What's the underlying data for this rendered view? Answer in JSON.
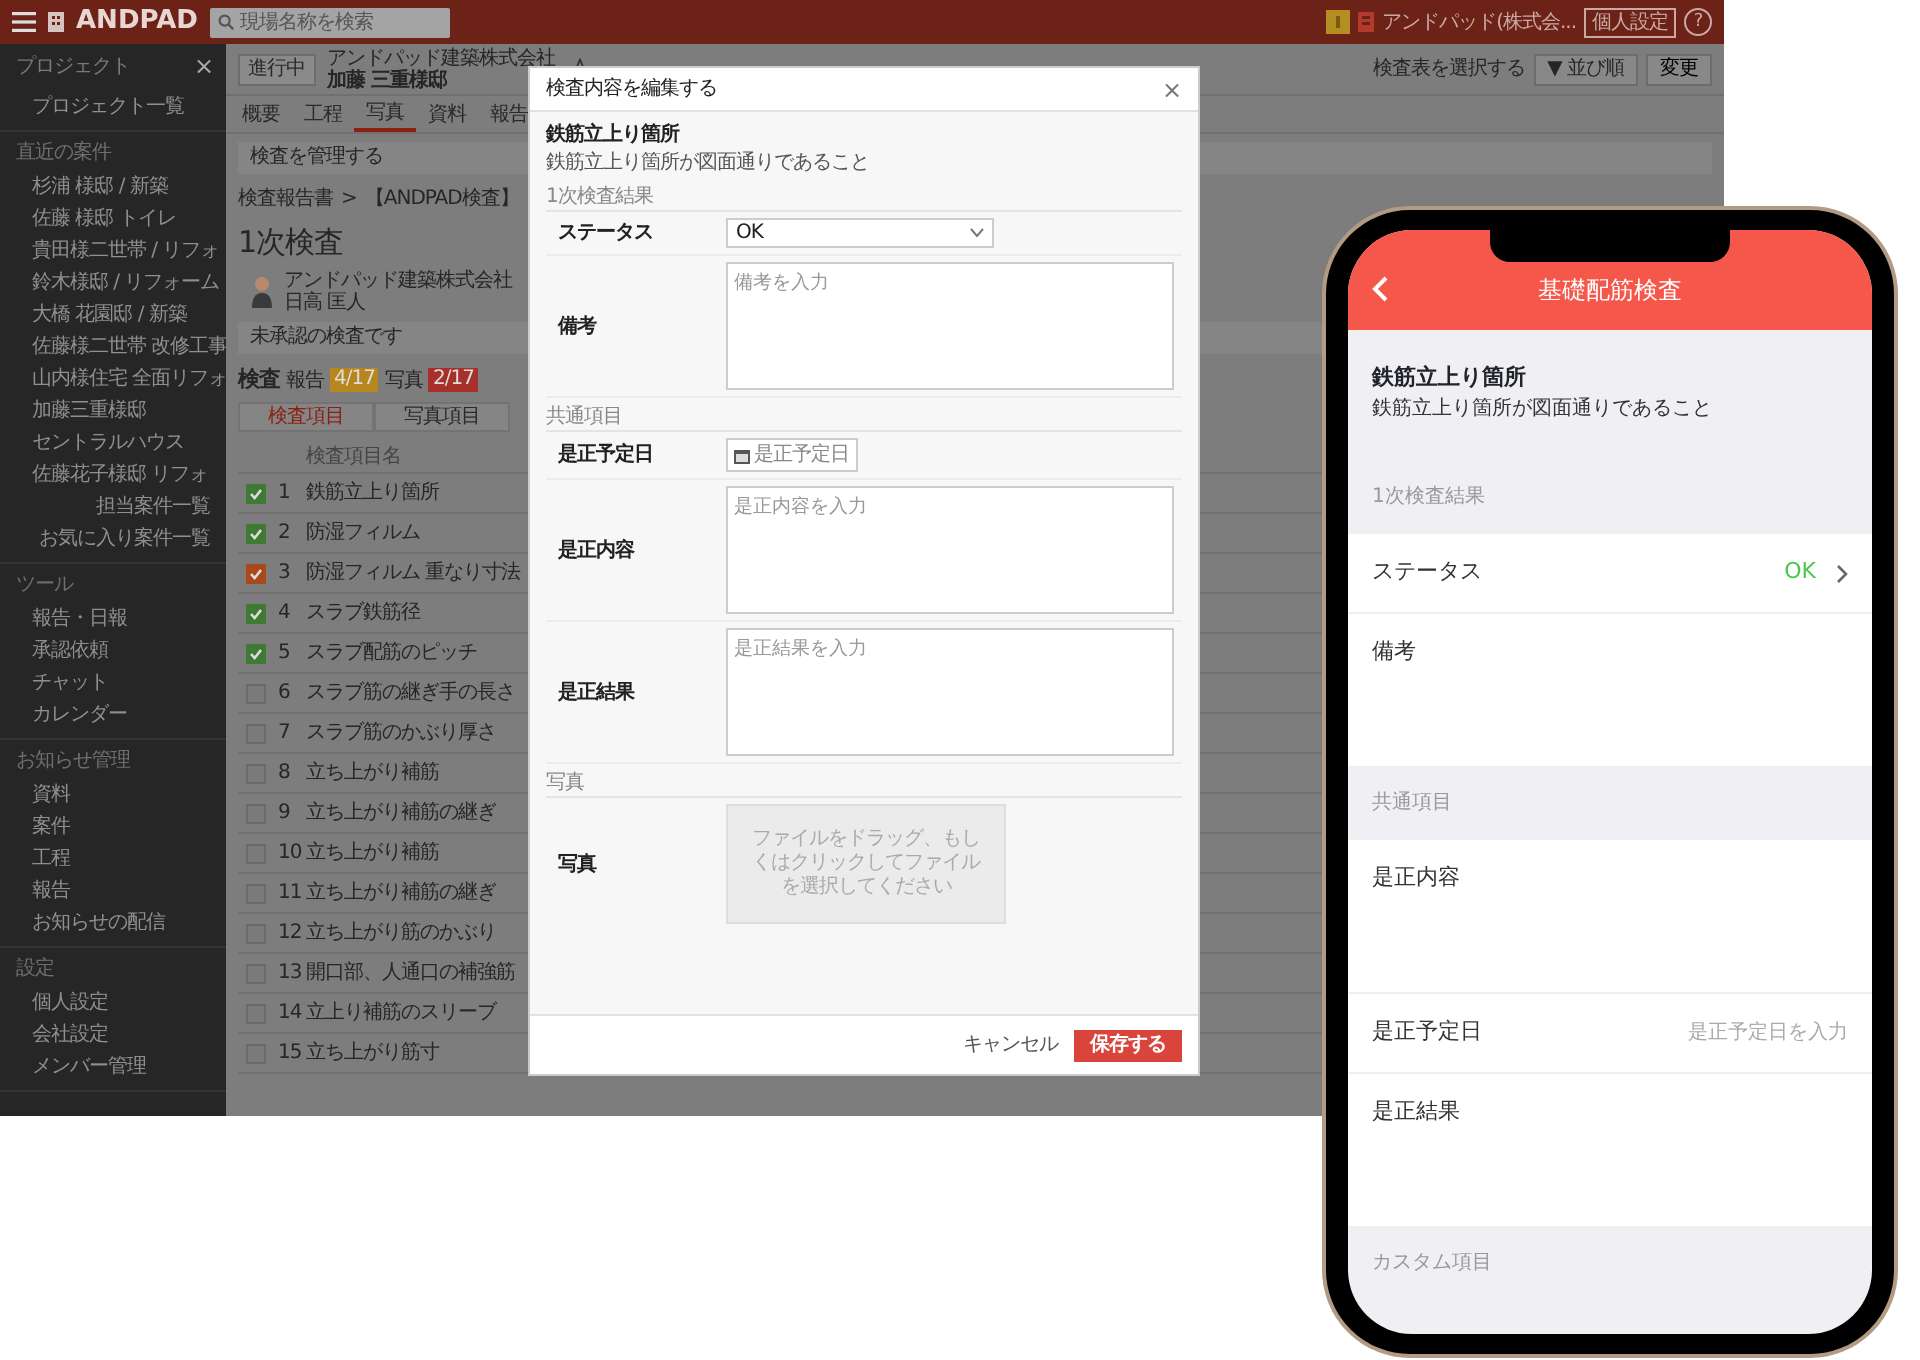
{
  "topbar": {
    "logo": "ANDPAD",
    "search_placeholder": "現場名称を検索",
    "user": "アンドパッド(株式会...",
    "settings_button": "個人設定",
    "help": "?"
  },
  "sidebar": {
    "title": "プロジェクト",
    "close": "×",
    "sections": [
      {
        "items": [
          {
            "label": "プロジェクト一覧",
            "kind": "item"
          }
        ]
      },
      {
        "heading": "直近の案件",
        "items": [
          {
            "label": "杉浦 様邸 / 新築",
            "kind": "item"
          },
          {
            "label": "佐藤 様邸 トイレ",
            "kind": "item"
          },
          {
            "label": "貴田様二世帯 / リフォ",
            "kind": "item"
          },
          {
            "label": "鈴木様邸 / リフォーム",
            "kind": "item"
          },
          {
            "label": "大橋 花園邸 / 新築",
            "kind": "item"
          },
          {
            "label": "佐藤様二世帯 改修工事",
            "kind": "item"
          },
          {
            "label": "山内様住宅 全面リフォ",
            "kind": "item"
          },
          {
            "label": "加藤三重様邸",
            "kind": "item"
          },
          {
            "label": "セントラルハウス",
            "kind": "item"
          },
          {
            "label": "佐藤花子様邸 リフォ",
            "kind": "item"
          },
          {
            "label": "担当案件一覧",
            "kind": "shortcut"
          },
          {
            "label": "お気に入り案件一覧",
            "kind": "shortcut"
          }
        ]
      },
      {
        "heading": "ツール",
        "items": [
          {
            "label": "報告・日報",
            "kind": "item"
          },
          {
            "label": "承認依頼",
            "kind": "item"
          },
          {
            "label": "チャット",
            "kind": "item"
          },
          {
            "label": "カレンダー",
            "kind": "item"
          }
        ]
      },
      {
        "heading": "お知らせ管理",
        "items": [
          {
            "label": "資料",
            "kind": "item"
          },
          {
            "label": "案件",
            "kind": "item"
          },
          {
            "label": "工程",
            "kind": "item"
          },
          {
            "label": "報告",
            "kind": "item"
          },
          {
            "label": "お知らせの配信",
            "kind": "item"
          }
        ]
      },
      {
        "heading": "設定",
        "items": [
          {
            "label": "個人設定",
            "kind": "item"
          },
          {
            "label": "会社設定",
            "kind": "item"
          },
          {
            "label": "メンバー管理",
            "kind": "item"
          }
        ]
      }
    ]
  },
  "main": {
    "project": {
      "status": "進行中",
      "company": "アンドパッド建築株式会社",
      "name": "加藤 三重様邸",
      "starred": false
    },
    "toolbar": {
      "label": "検査表を選択する",
      "select": "▼ 並び順",
      "button": "変更"
    },
    "tabs": [
      {
        "label": "概要",
        "selected": false
      },
      {
        "label": "工程",
        "selected": false
      },
      {
        "label": "写真",
        "selected": true
      },
      {
        "label": "資料",
        "selected": false
      },
      {
        "label": "報告",
        "selected": false
      }
    ],
    "section_bar": "検査を管理する",
    "breadcrumb": {
      "items": [
        "検査報告書",
        "【ANDPAD検査】"
      ],
      "separator": ">"
    },
    "title": "1次検査",
    "inspector": {
      "company": "アンドパッド建築株式会社",
      "name": "日高 匡人"
    },
    "notice": "未承認の検査です",
    "summary": {
      "label": "検査",
      "counts": [
        {
          "label": "報告",
          "value": "4/17",
          "color": "#b7861f"
        },
        {
          "label": "写真",
          "value": "2/17",
          "color": "#a8302a"
        }
      ]
    },
    "list_tabs": [
      {
        "label": "検査項目",
        "selected": true
      },
      {
        "label": "写真項目",
        "selected": false
      }
    ],
    "list": {
      "column": "検査項目名",
      "rows": [
        {
          "number": "1",
          "name": "鉄筋立上り箇所",
          "checked": true,
          "color": "#3f7a35"
        },
        {
          "number": "2",
          "name": "防湿フィルム",
          "checked": true,
          "color": "#3f7a35"
        },
        {
          "number": "3",
          "name": "防湿フィルム 重なり寸法",
          "checked": true,
          "color": "#a8491a"
        },
        {
          "number": "4",
          "name": "スラブ鉄筋径",
          "checked": true,
          "color": "#3f7a35"
        },
        {
          "number": "5",
          "name": "スラブ配筋のピッチ",
          "checked": true,
          "color": "#3f7a35"
        },
        {
          "number": "6",
          "name": "スラブ筋の継ぎ手の長さ",
          "checked": false
        },
        {
          "number": "7",
          "name": "スラブ筋のかぶり厚さ",
          "checked": false
        },
        {
          "number": "8",
          "name": "立ち上がり補筋",
          "checked": false
        },
        {
          "number": "9",
          "name": "立ち上がり補筋の継ぎ",
          "checked": false
        },
        {
          "number": "10",
          "name": "立ち上がり補筋",
          "checked": false
        },
        {
          "number": "11",
          "name": "立ち上がり補筋の継ぎ",
          "checked": false
        },
        {
          "number": "12",
          "name": "立ち上がり筋のかぶり",
          "checked": false
        },
        {
          "number": "13",
          "name": "開口部、人通口の補強筋",
          "checked": false
        },
        {
          "number": "14",
          "name": "立上り補筋のスリーブ",
          "checked": false
        },
        {
          "number": "15",
          "name": "立ち上がり筋寸",
          "checked": false
        }
      ]
    }
  },
  "modal": {
    "title": "検査内容を編集する",
    "close": "×",
    "item_name": "鉄筋立上り箇所",
    "item_desc": "鉄筋立上り箇所が図面通りであること",
    "sections": [
      {
        "heading": "1次検査結果",
        "fields": [
          {
            "label": "ステータス",
            "kind": "select",
            "value": "OK"
          },
          {
            "label": "備考",
            "kind": "textarea",
            "placeholder": "備考を入力"
          }
        ]
      },
      {
        "heading": "共通項目",
        "fields": [
          {
            "label": "是正予定日",
            "kind": "date",
            "text": "是正予定日"
          },
          {
            "label": "是正内容",
            "kind": "textarea",
            "placeholder": "是正内容を入力"
          },
          {
            "label": "是正結果",
            "kind": "textarea",
            "placeholder": "是正結果を入力"
          }
        ]
      },
      {
        "heading": "写真",
        "fields": [
          {
            "label": "写真",
            "kind": "dropzone",
            "text": "ファイルをドラッグ、もしくはクリックしてファイルを選択してください"
          }
        ]
      }
    ],
    "cancel": "キャンセル",
    "save": "保存する"
  },
  "phone": {
    "title": "基礎配筋検査",
    "item_name": "鉄筋立上り箇所",
    "item_desc": "鉄筋立上り箇所が図面通りであること",
    "sections": [
      {
        "heading": "1次検査結果",
        "rows": [
          {
            "label": "ステータス",
            "kind": "select",
            "value": "OK"
          },
          {
            "label": "備考",
            "kind": "textarea"
          }
        ]
      },
      {
        "heading": "共通項目",
        "rows": [
          {
            "label": "是正内容",
            "kind": "textarea"
          },
          {
            "label": "是正予定日",
            "kind": "input",
            "placeholder": "是正予定日を入力"
          },
          {
            "label": "是正結果",
            "kind": "textarea"
          }
        ]
      },
      {
        "heading": "カスタム項目"
      }
    ]
  }
}
